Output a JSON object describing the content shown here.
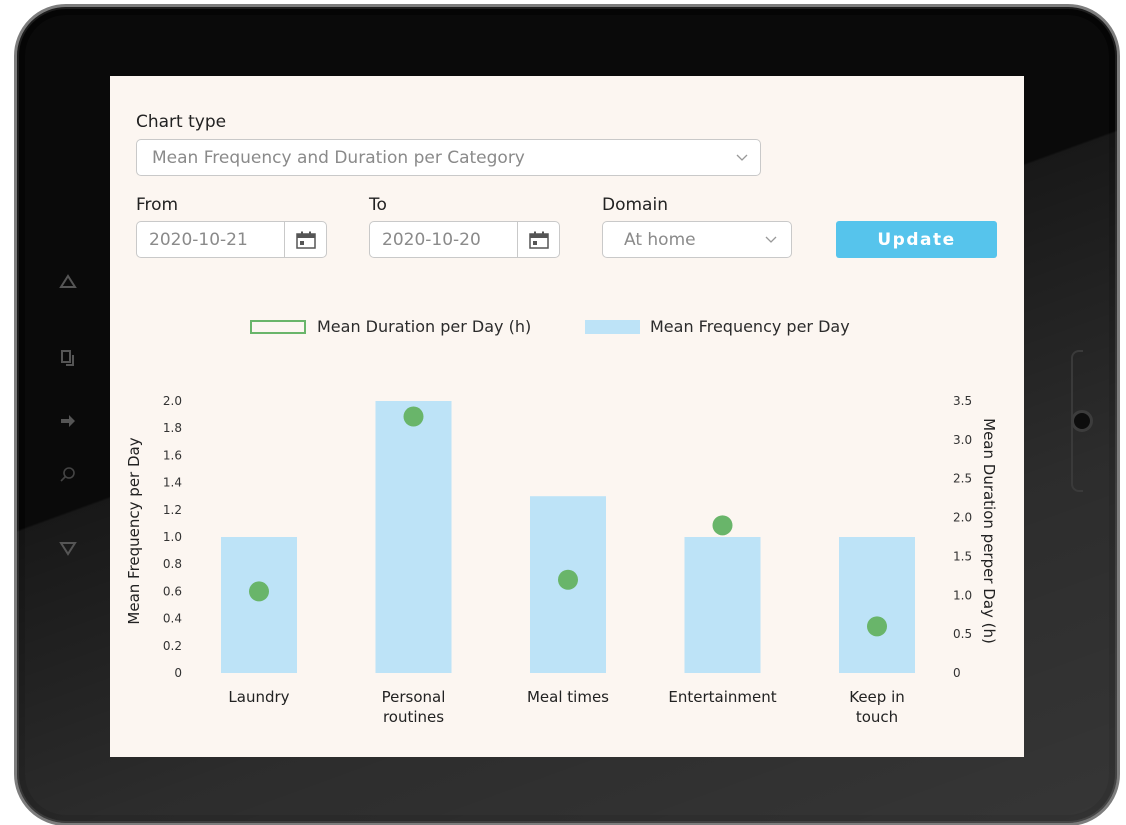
{
  "form": {
    "chart_type_label": "Chart type",
    "chart_type_value": "Mean Frequency and Duration per Category",
    "from_label": "From",
    "from_value": "2020-10-21",
    "to_label": "To",
    "to_value": "2020-10-20",
    "domain_label": "Domain",
    "domain_value": "At home",
    "update_label": "Update"
  },
  "icons": {
    "nav_up": "triangle-up-icon",
    "nav_copy": "copy-icon",
    "nav_share": "share-icon",
    "nav_search": "search-icon",
    "nav_down": "triangle-down-icon",
    "calendar": "calendar-icon",
    "dropdown": "chevron-down-icon"
  },
  "colors": {
    "bar": "#bde3f7",
    "point": "#69b56a",
    "button": "#56c4ec",
    "screen_bg": "#fcf6f1"
  },
  "chart_data": {
    "type": "bar",
    "categories": [
      "Laundry",
      "Personal routines",
      "Meal times",
      "Entertainment",
      "Keep in touch"
    ],
    "category_lines": [
      [
        "Laundry"
      ],
      [
        "Personal",
        "routines"
      ],
      [
        "Meal times"
      ],
      [
        "Entertainment"
      ],
      [
        "Keep in",
        "touch"
      ]
    ],
    "series": [
      {
        "name": "Mean Frequency per Day",
        "type": "bar",
        "axis": "left",
        "values": [
          1.0,
          2.0,
          1.3,
          1.0,
          1.0
        ]
      },
      {
        "name": "Mean Duration per Day (h)",
        "type": "point",
        "axis": "right",
        "values": [
          1.05,
          3.3,
          1.2,
          1.9,
          0.6
        ]
      }
    ],
    "y_left": {
      "label": "Mean Frequency per Day",
      "ylim": [
        0,
        2.0
      ],
      "ticks": [
        "0",
        "0.2",
        "0.4",
        "0.6",
        "0.8",
        "1.0",
        "1.2",
        "1.4",
        "1.6",
        "1.8",
        "2.0"
      ]
    },
    "y_right": {
      "label": "Mean Duration perper Day (h)",
      "ylim": [
        0,
        3.5
      ],
      "ticks": [
        "0",
        "0.5",
        "1.0",
        "1.5",
        "2.0",
        "2.5",
        "3.0",
        "3.5"
      ]
    },
    "legend_position": "top-center",
    "grid": false
  }
}
